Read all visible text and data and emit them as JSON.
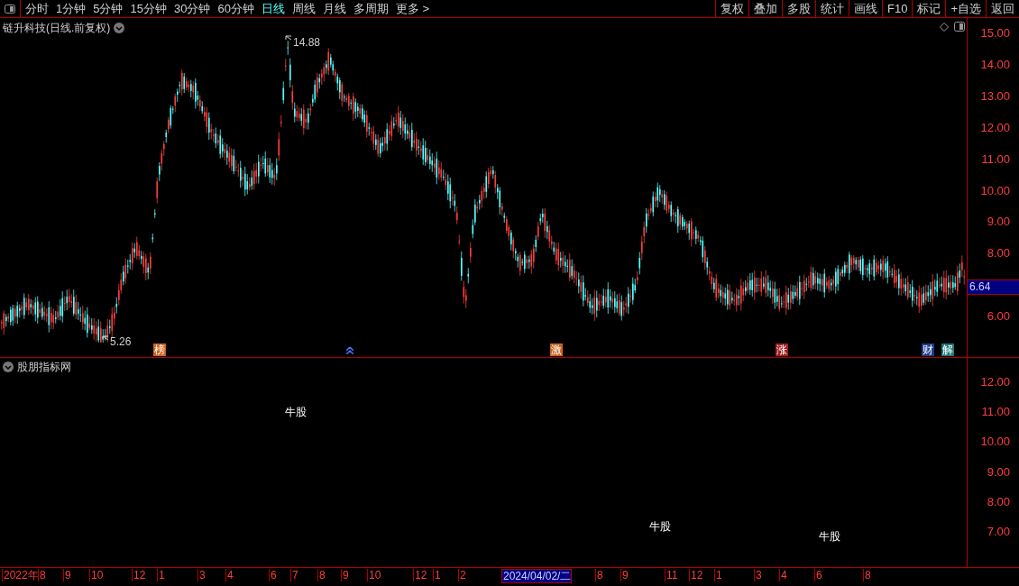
{
  "toolbar": {
    "periods": [
      {
        "label": "分时",
        "selected": false
      },
      {
        "label": "1分钟",
        "selected": false
      },
      {
        "label": "5分钟",
        "selected": false
      },
      {
        "label": "15分钟",
        "selected": false
      },
      {
        "label": "30分钟",
        "selected": false
      },
      {
        "label": "60分钟",
        "selected": false
      },
      {
        "label": "日线",
        "selected": true
      },
      {
        "label": "周线",
        "selected": false
      },
      {
        "label": "月线",
        "selected": false
      },
      {
        "label": "多周期",
        "selected": false
      },
      {
        "label": "更多 >",
        "selected": false
      }
    ],
    "buttons": [
      "复权",
      "叠加",
      "多股",
      "统计",
      "画线",
      "F10",
      "标记",
      "+自选",
      "返回"
    ]
  },
  "main_chart": {
    "title": "链升科技(日线.前复权)",
    "high_label": "14.88",
    "low_label": "5.26",
    "current_price": "6.64",
    "price_axis": [
      "15.00",
      "14.00",
      "13.00",
      "12.00",
      "11.00",
      "10.00",
      "9.00",
      "8.00",
      "6.00"
    ],
    "markers": [
      {
        "kind": "badge",
        "text": "榜",
        "color": "#c8641e"
      },
      {
        "kind": "arrow",
        "color": "#3c78ff"
      },
      {
        "kind": "badge",
        "text": "激",
        "color": "#c8641e"
      },
      {
        "kind": "badge",
        "text": "涨",
        "color": "#a01e1e"
      },
      {
        "kind": "badge",
        "text": "财",
        "color": "#1e3c8c"
      },
      {
        "kind": "badge",
        "text": "解",
        "color": "#1e7878"
      }
    ]
  },
  "indicator_panel": {
    "title": "股朋指标网",
    "labels": [
      "牛股",
      "牛股",
      "牛股"
    ],
    "axis": [
      "12.00",
      "11.00",
      "10.00",
      "9.00",
      "8.00",
      "7.00"
    ]
  },
  "time_axis": [
    {
      "label": "2022年",
      "selected": false
    },
    {
      "label": "8",
      "selected": false
    },
    {
      "label": "9",
      "selected": false
    },
    {
      "label": "10",
      "selected": false
    },
    {
      "label": "12",
      "selected": false
    },
    {
      "label": "1",
      "selected": false
    },
    {
      "label": "3",
      "selected": false
    },
    {
      "label": "4",
      "selected": false
    },
    {
      "label": "6",
      "selected": false
    },
    {
      "label": "7",
      "selected": false
    },
    {
      "label": "8",
      "selected": false
    },
    {
      "label": "9",
      "selected": false
    },
    {
      "label": "10",
      "selected": false
    },
    {
      "label": "12",
      "selected": false
    },
    {
      "label": "1",
      "selected": false
    },
    {
      "label": "2",
      "selected": false
    },
    {
      "label": "2024/04/02/二",
      "selected": true
    },
    {
      "label": "8",
      "selected": false
    },
    {
      "label": "9",
      "selected": false
    },
    {
      "label": "11",
      "selected": false
    },
    {
      "label": "12",
      "selected": false
    },
    {
      "label": "1",
      "selected": false
    },
    {
      "label": "3",
      "selected": false
    },
    {
      "label": "4",
      "selected": false
    },
    {
      "label": "6",
      "selected": false
    },
    {
      "label": "8",
      "selected": false
    }
  ]
}
